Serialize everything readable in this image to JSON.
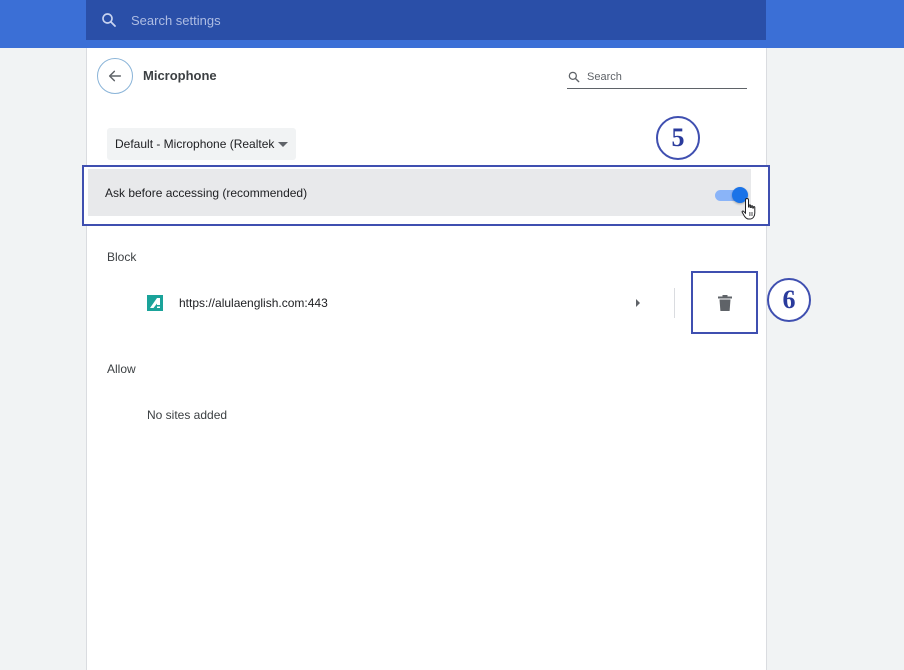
{
  "search_bar": {
    "placeholder": "Search settings",
    "icon": "search-icon"
  },
  "header": {
    "back_icon": "arrow-back-icon",
    "title": "Microphone",
    "search_placeholder": "Search",
    "search_icon": "search-icon"
  },
  "device_select": {
    "selected": "Default - Microphone (Realtek"
  },
  "ask_setting": {
    "label": "Ask before accessing (recommended)",
    "enabled": true,
    "accent_color": "#1a73e8"
  },
  "annotations": {
    "step_a": "5",
    "step_b": "6",
    "color": "#3f4fb0"
  },
  "block": {
    "label": "Block",
    "sites": [
      {
        "url": "https://alulaenglish.com:443"
      }
    ]
  },
  "allow": {
    "label": "Allow",
    "empty_text": "No sites added"
  },
  "colors": {
    "top_bar": "#3b6fd6",
    "search_box": "#2a4fa8",
    "toggle_thumb": "#1a73e8",
    "toggle_track": "#8ab4f8",
    "site_icon": "#1aa39a"
  }
}
